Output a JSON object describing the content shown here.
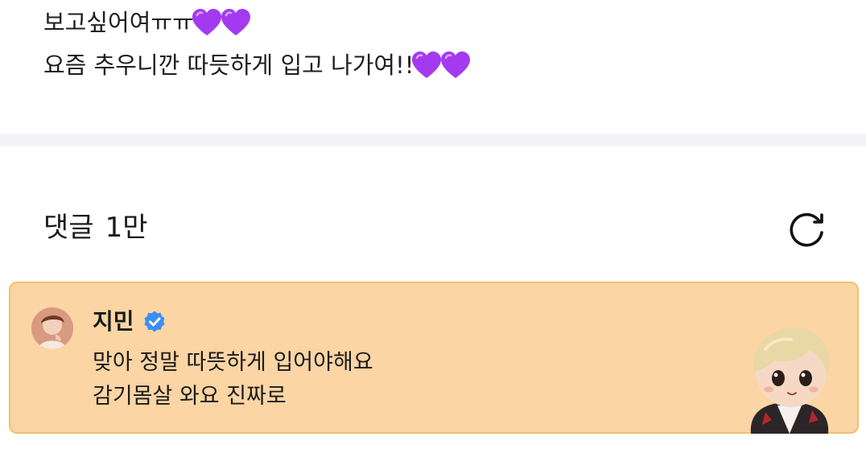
{
  "post": {
    "line1": "보고싶어여ㅠㅠ",
    "line2": "요즘 추우니깐 따듯하게 입고 나가여!!",
    "emoji": "purple-heart"
  },
  "comments_header": {
    "title": "댓글",
    "count": "1만"
  },
  "pinned_comment": {
    "author": "지민",
    "verified": true,
    "lines": [
      "맞아 정말 따뜻하게 입어야해요",
      "감기몸살 와요 진짜로"
    ],
    "background_color": "#fbd5a4",
    "border_color": "#f2bf6e"
  },
  "colors": {
    "heart": "#a33af0",
    "badge": "#3b8ef5",
    "divider": "#f3f4f7"
  },
  "icons": {
    "refresh": "refresh-icon",
    "verified": "verified-badge-icon",
    "sticker": "character-sticker"
  }
}
